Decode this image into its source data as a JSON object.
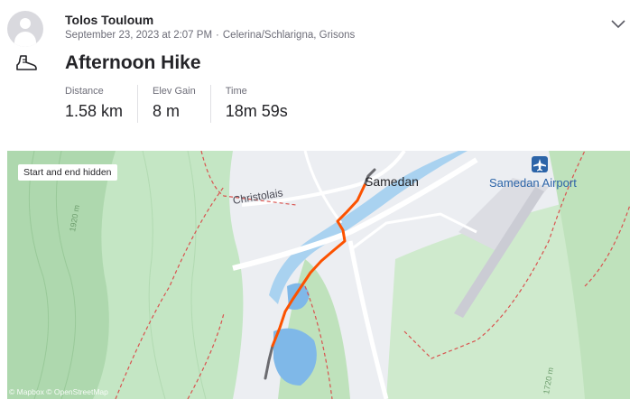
{
  "athlete": {
    "name": "Tolos Touloum"
  },
  "activity": {
    "date": "September 23, 2023 at 2:07 PM",
    "separator": "·",
    "location": "Celerina/Schlarigna, Grisons",
    "title": "Afternoon Hike",
    "sport_icon": "hiking-boot-icon"
  },
  "stats": [
    {
      "label": "Distance",
      "value": "1.58 km"
    },
    {
      "label": "Elev Gain",
      "value": "8 m"
    },
    {
      "label": "Time",
      "value": "18m 59s"
    }
  ],
  "map": {
    "privacy_badge": "Start and end hidden",
    "town_label": "Samedan",
    "airport_label": "Samedan Airport",
    "place_label": "Christolais",
    "attribution": "© Mapbox © OpenStreetMap",
    "colors": {
      "route": "#fc5200",
      "hidden_route": "#6b6b70",
      "forest": "#c4e6c4",
      "road": "#ffffff",
      "water": "#7fb8e8",
      "trail": "#d9534f",
      "airport": "#2c64a8"
    }
  }
}
